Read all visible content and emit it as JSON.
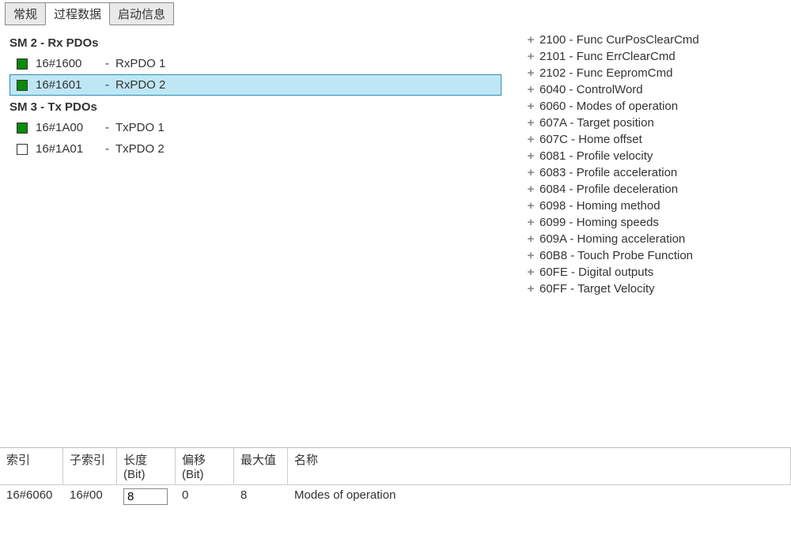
{
  "tabs": {
    "general": "常规",
    "process": "过程数据",
    "startup": "启动信息"
  },
  "left": {
    "sm2_title": "SM 2 - Rx PDOs",
    "sm3_title": "SM 3 - Tx PDOs",
    "rx1_idx": "16#1600",
    "rx1_name": "RxPDO 1",
    "rx1_checked": true,
    "rx2_idx": "16#1601",
    "rx2_name": "RxPDO 2",
    "rx2_checked": true,
    "tx1_idx": "16#1A00",
    "tx1_name": "TxPDO 1",
    "tx1_checked": true,
    "tx2_idx": "16#1A01",
    "tx2_name": "TxPDO 2",
    "tx2_checked": false,
    "dash": "-"
  },
  "entries": [
    "2100 - Func CurPosClearCmd",
    "2101 - Func ErrClearCmd",
    "2102 - Func EepromCmd",
    "6040 - ControlWord",
    "6060 - Modes of operation",
    "607A - Target position",
    "607C - Home offset",
    "6081 - Profile velocity",
    "6083 - Profile acceleration",
    "6084 - Profile deceleration",
    "6098 - Homing method",
    "6099 - Homing speeds",
    "609A - Homing acceleration",
    "60B8 - Touch Probe Function",
    "60FE - Digital outputs",
    "60FF - Target Velocity"
  ],
  "table": {
    "headers": {
      "idx": "索引",
      "sub": "子索引",
      "len": "长度(Bit)",
      "off": "偏移(Bit)",
      "max": "最大值",
      "name": "名称"
    },
    "row": {
      "idx": "16#6060",
      "sub": "16#00",
      "len": "8",
      "off": "0",
      "max": "8",
      "name": "Modes of operation"
    }
  }
}
